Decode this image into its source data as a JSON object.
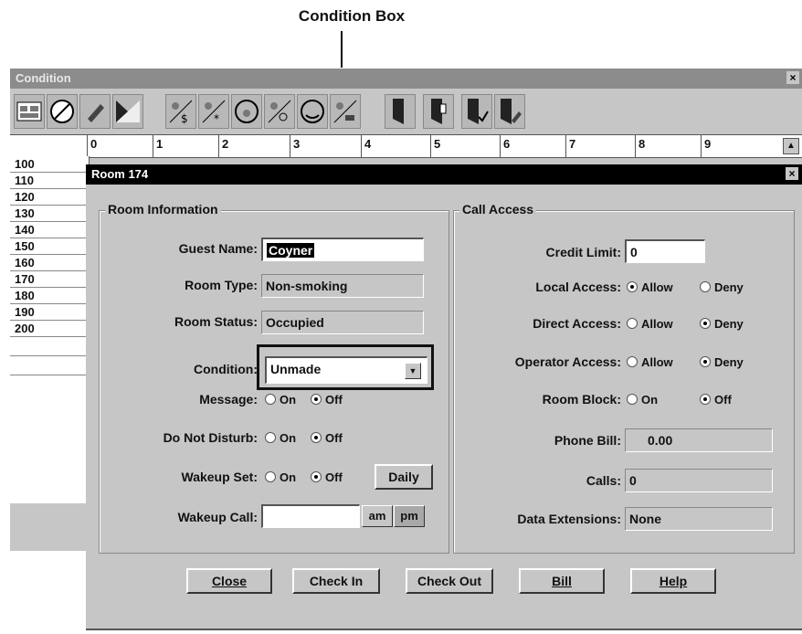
{
  "annotation": {
    "label": "Condition Box"
  },
  "condition_window": {
    "title": "Condition",
    "close_symbol": "×",
    "toolbar": [
      "room-map-icon",
      "no-smoking-icon",
      "pencil-icon",
      "bed-made-icon",
      "vacuum-dollar-icon",
      "vacuum-star-icon",
      "vacuum-clock-icon",
      "vacuum-timer-icon",
      "vacuum-phone-icon",
      "vacuum-brush-icon",
      "door-icon",
      "door-open-icon",
      "door-check-icon",
      "door-pencil-icon"
    ],
    "grid_columns": [
      "0",
      "1",
      "2",
      "3",
      "4",
      "5",
      "6",
      "7",
      "8",
      "9"
    ],
    "scroll_symbol": "▲",
    "rooms": [
      "100",
      "110",
      "120",
      "130",
      "140",
      "150",
      "160",
      "170",
      "180",
      "190",
      "200",
      "",
      ""
    ]
  },
  "dialog": {
    "title": "Room 174",
    "close_symbol": "×",
    "room_info": {
      "heading": "Room Information",
      "guest_name_label": "Guest Name:",
      "guest_name_value": "Coyner",
      "room_type_label": "Room Type:",
      "room_type_value": "Non-smoking",
      "room_status_label": "Room Status:",
      "room_status_value": "Occupied",
      "condition_label": "Condition:",
      "condition_value": "Unmade",
      "message_label": "Message:",
      "dnd_label": "Do Not Disturb:",
      "wakeup_set_label": "Wakeup Set:",
      "wakeup_call_label": "Wakeup Call:",
      "wakeup_call_value": "",
      "on_label": "On",
      "off_label": "Off",
      "daily_label": "Daily",
      "am_label": "am",
      "pm_label": "pm"
    },
    "call_access": {
      "heading": "Call Access",
      "credit_limit_label": "Credit Limit:",
      "credit_limit_value": "0",
      "local_access_label": "Local Access:",
      "direct_access_label": "Direct Access:",
      "operator_access_label": "Operator Access:",
      "room_block_label": "Room Block:",
      "allow_label": "Allow",
      "deny_label": "Deny",
      "on_label": "On",
      "off_label": "Off",
      "phone_bill_label": "Phone Bill:",
      "phone_bill_value": "0.00",
      "calls_label": "Calls:",
      "calls_value": "0",
      "data_ext_label": "Data Extensions:",
      "data_ext_value": "None"
    },
    "buttons": {
      "close": "Close",
      "check_in": "Check In",
      "check_out": "Check Out",
      "bill": "Bill",
      "help": "Help"
    }
  }
}
